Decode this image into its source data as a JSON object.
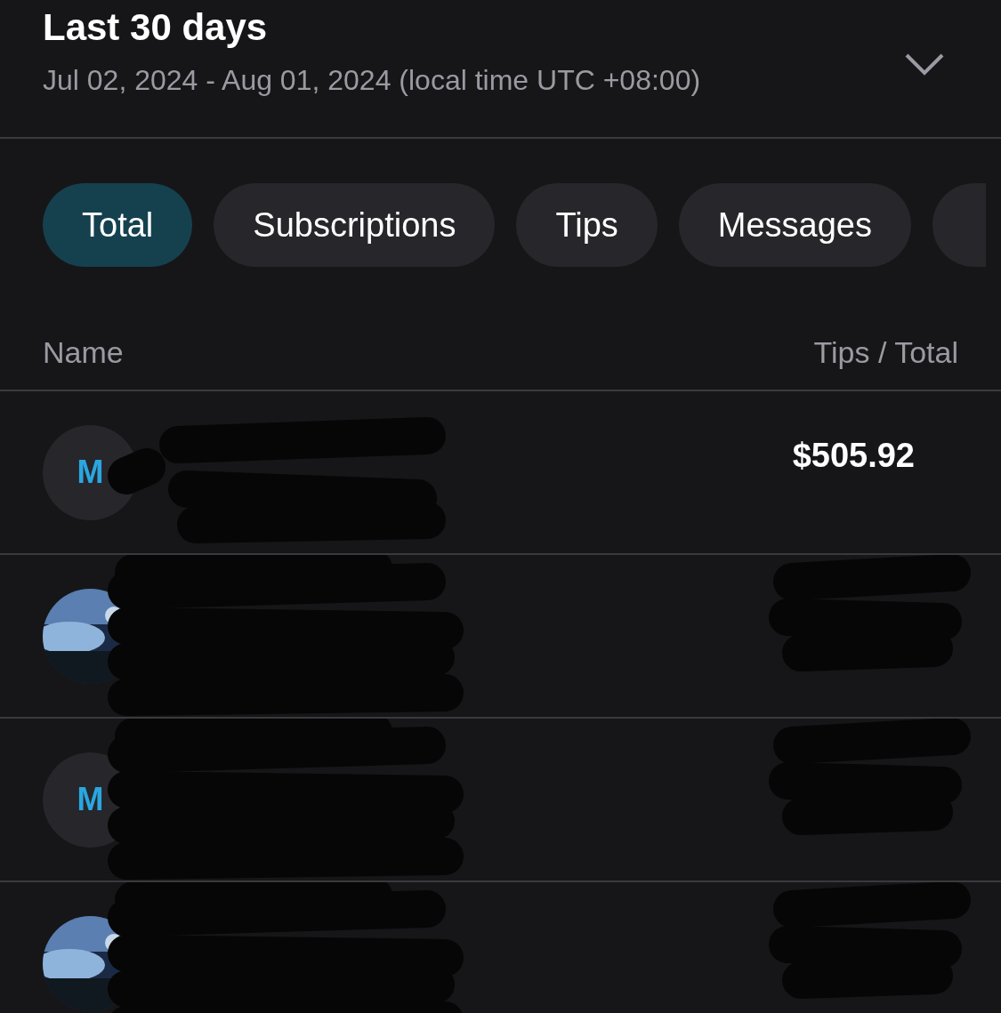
{
  "header": {
    "title": "Last 30 days",
    "date_range": "Jul 02, 2024 - Aug 01, 2024 (local time UTC +08:00)",
    "expanded": false
  },
  "tabs": [
    {
      "label": "Total",
      "selected": true
    },
    {
      "label": "Subscriptions",
      "selected": false
    },
    {
      "label": "Tips",
      "selected": false
    },
    {
      "label": "Messages",
      "selected": false
    }
  ],
  "tabs_overflow": true,
  "table": {
    "columns": [
      "Name",
      "Tips / Total"
    ],
    "rows": [
      {
        "avatar": {
          "kind": "initials",
          "initials": "M"
        },
        "amount": "$505.92",
        "name_redacted": true,
        "amount_redacted": false
      },
      {
        "name_redacted": true,
        "amount_redacted": true
      },
      {
        "avatar": {
          "kind": "initials",
          "initials": "M"
        },
        "name_redacted": true,
        "amount_redacted": true
      },
      {
        "name_redacted": true,
        "amount_redacted": true
      }
    ]
  }
}
